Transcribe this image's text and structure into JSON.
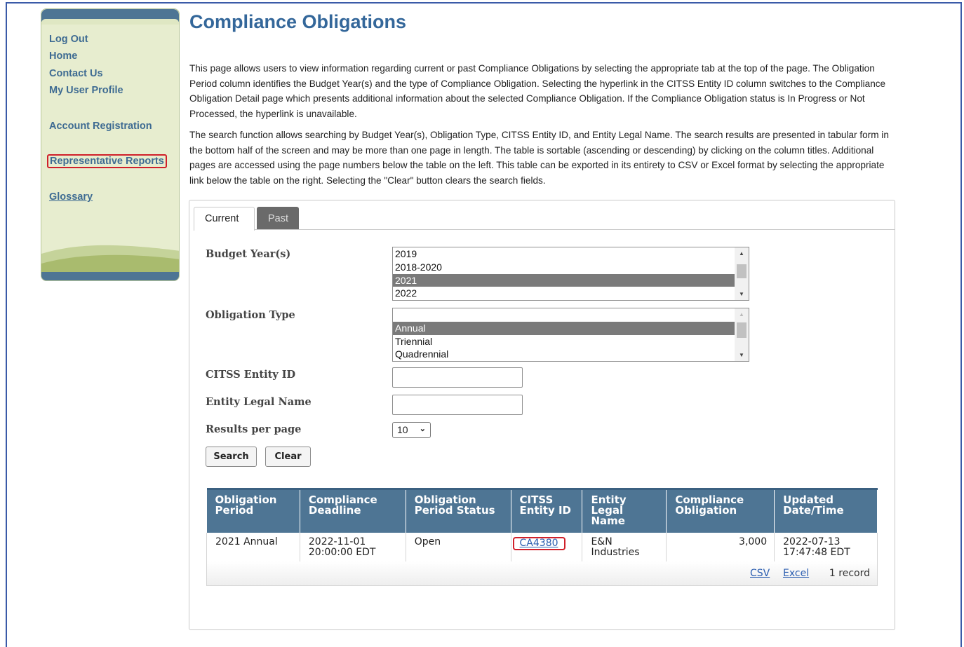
{
  "sidebar": {
    "links": [
      "Log Out",
      "Home",
      "Contact Us",
      "My User Profile",
      "Account Registration",
      "Representative Reports",
      "Glossary"
    ]
  },
  "page": {
    "title": "Compliance Obligations",
    "intro1": "This page allows users to view information regarding current or past Compliance Obligations by selecting the appropriate tab at the top of the page. The Obligation Period column identifies the Budget Year(s) and the type of Compliance Obligation. Selecting the hyperlink in the CITSS Entity ID column switches to the Compliance Obligation Detail page which presents additional information about the selected Compliance Obligation. If the Compliance Obligation status is In Progress or Not Processed, the hyperlink is unavailable.",
    "intro2": "The search function allows searching by Budget Year(s), Obligation Type, CITSS Entity ID, and Entity Legal Name. The search results are presented in tabular form in the bottom half of the screen and may be more than one page in length. The table is sortable (ascending or descending) by clicking on the column titles. Additional pages are accessed using the page numbers below the table on the left. This table can be exported in its entirety to CSV or Excel format by selecting the appropriate link below the table on the right. Selecting the \"Clear\" button clears the search fields."
  },
  "tabs": [
    "Current",
    "Past"
  ],
  "form": {
    "budget_label": "Budget Year(s)",
    "budget_options": [
      "2019",
      "2018-2020",
      "2021",
      "2022"
    ],
    "budget_selected": "2021",
    "obligation_label": "Obligation Type",
    "obligation_options": [
      "",
      "Annual",
      "Triennial",
      "Quadrennial"
    ],
    "obligation_selected": "Annual",
    "entity_id_label": "CITSS Entity ID",
    "entity_id_value": "",
    "legal_name_label": "Entity Legal Name",
    "legal_name_value": "",
    "results_label": "Results per page",
    "results_value": "10",
    "search_label": "Search",
    "clear_label": "Clear"
  },
  "table": {
    "headers": [
      "Obligation Period",
      "Compliance Deadline",
      "Obligation Period Status",
      "CITSS Entity ID",
      "Entity Legal Name",
      "Compliance Obligation",
      "Updated Date/Time"
    ],
    "row": {
      "period": "2021 Annual",
      "deadline": "2022-11-01 20:00:00 EDT",
      "status": "Open",
      "entity_id": "CA4380",
      "legal_name": "E&N Industries",
      "obligation": "3,000",
      "updated": "2022-07-13 17:47:48 EDT"
    },
    "footer": {
      "csv": "CSV",
      "excel": "Excel",
      "count": "1 record"
    }
  }
}
